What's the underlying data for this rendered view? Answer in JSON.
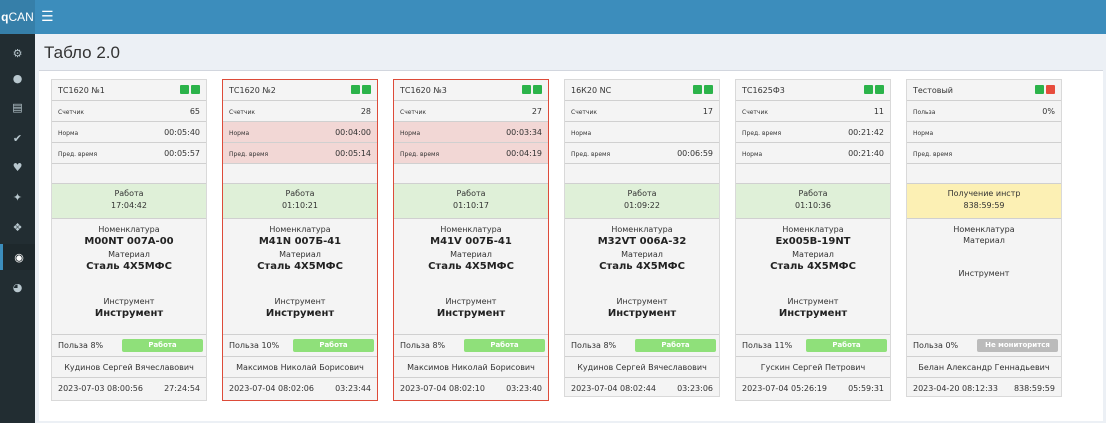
{
  "app": {
    "logo_q": "q",
    "logo_rest": "CAN"
  },
  "page": {
    "title": "Табло 2.0"
  },
  "cards": [
    {
      "name": "ТС1620 №1",
      "alert": false,
      "leds": [
        "#2bb34a",
        "#2bb34a"
      ],
      "row1_label": "Счетчик",
      "row1_value": "65",
      "row2_label": "Норма",
      "row2_value": "00:05:40",
      "row3_label": "Пред. время",
      "row3_value": "00:05:57",
      "status": "Работа",
      "status_time": "17:04:42",
      "status_color": "green",
      "nomenclature_label": "Номенклатура",
      "nomenclature": "M00NT 007A-00",
      "material_label": "Материал",
      "material": "Сталь 4Х5МФС",
      "tool_label": "Инструмент",
      "tool": "Инструмент",
      "utility": "Польза 8%",
      "badge": "Работа",
      "badge_grey": false,
      "operator": "Кудинов Сергей Вячеславович",
      "footer_date": "2023-07-03 08:00:56",
      "footer_time": "27:24:54"
    },
    {
      "name": "ТС1620 №2",
      "alert": true,
      "leds": [
        "#2bb34a",
        "#2bb34a"
      ],
      "row1_label": "Счетчик",
      "row1_value": "28",
      "row2_label": "Норма",
      "row2_value": "00:04:00",
      "row3_label": "Пред. время",
      "row3_value": "00:05:14",
      "status": "Работа",
      "status_time": "01:10:21",
      "status_color": "green",
      "nomenclature_label": "Номенклатура",
      "nomenclature": "M41N 007Б-41",
      "material_label": "Материал",
      "material": "Сталь 4Х5МФС",
      "tool_label": "Инструмент",
      "tool": "Инструмент",
      "utility": "Польза 10%",
      "badge": "Работа",
      "badge_grey": false,
      "operator": "Максимов Николай Борисович",
      "footer_date": "2023-07-04 08:02:06",
      "footer_time": "03:23:44"
    },
    {
      "name": "ТС1620 №3",
      "alert": true,
      "leds": [
        "#2bb34a",
        "#2bb34a"
      ],
      "row1_label": "Счетчик",
      "row1_value": "27",
      "row2_label": "Норма",
      "row2_value": "00:03:34",
      "row3_label": "Пред. время",
      "row3_value": "00:04:19",
      "status": "Работа",
      "status_time": "01:10:17",
      "status_color": "green",
      "nomenclature_label": "Номенклатура",
      "nomenclature": "M41V 007Б-41",
      "material_label": "Материал",
      "material": "Сталь 4Х5МФС",
      "tool_label": "Инструмент",
      "tool": "Инструмент",
      "utility": "Польза 8%",
      "badge": "Работа",
      "badge_grey": false,
      "operator": "Максимов Николай Борисович",
      "footer_date": "2023-07-04 08:02:10",
      "footer_time": "03:23:40"
    },
    {
      "name": "16К20 NC",
      "alert": false,
      "leds": [
        "#2bb34a",
        "#2bb34a"
      ],
      "row1_label": "Счетчик",
      "row1_value": "17",
      "row2_label": "Норма",
      "row2_value": "",
      "row3_label": "Пред. время",
      "row3_value": "00:06:59",
      "status": "Работа",
      "status_time": "01:09:22",
      "status_color": "green",
      "nomenclature_label": "Номенклатура",
      "nomenclature": "M32VT 006A-32",
      "material_label": "Материал",
      "material": "Сталь 4Х5МФС",
      "tool_label": "Инструмент",
      "tool": "Инструмент",
      "utility": "Польза 8%",
      "badge": "Работа",
      "badge_grey": false,
      "operator": "Кудинов Сергей Вячеславович",
      "footer_date": "2023-07-04 08:02:44",
      "footer_time": "03:23:06"
    },
    {
      "name": "ТС1625Ф3",
      "alert": false,
      "leds": [
        "#2bb34a",
        "#2bb34a"
      ],
      "row1_label": "Счетчик",
      "row1_value": "11",
      "row2_label": "Пред. время",
      "row2_value": "00:21:42",
      "row3_label": "Норма",
      "row3_value": "00:21:40",
      "status": "Работа",
      "status_time": "01:10:36",
      "status_color": "green",
      "nomenclature_label": "Номенклатура",
      "nomenclature": "Ex005B-19NT",
      "material_label": "Материал",
      "material": "Сталь 4Х5МФС",
      "tool_label": "Инструмент",
      "tool": "Инструмент",
      "utility": "Польза 11%",
      "badge": "Работа",
      "badge_grey": false,
      "operator": "Гускин Сергей Петрович",
      "footer_date": "2023-07-04 05:26:19",
      "footer_time": "05:59:31"
    },
    {
      "name": "Тестовый",
      "alert": false,
      "leds": [
        "#2bb34a",
        "#e74c3c"
      ],
      "row1_label": "Польза",
      "row1_value": "0%",
      "row2_label": "Норма",
      "row2_value": "",
      "row3_label": "Пред. время",
      "row3_value": "",
      "status": "Получение инстр",
      "status_time": "838:59:59",
      "status_color": "yellow",
      "nomenclature_label": "Номенклатура",
      "nomenclature": "",
      "material_label": "Материал",
      "material": "",
      "tool_label": "Инструмент",
      "tool": "",
      "utility": "Польза 0%",
      "badge": "Не мониторится",
      "badge_grey": true,
      "operator": "Белан Александр Геннадьевич",
      "footer_date": "2023-04-20 08:12:33",
      "footer_time": "838:59:59"
    }
  ]
}
